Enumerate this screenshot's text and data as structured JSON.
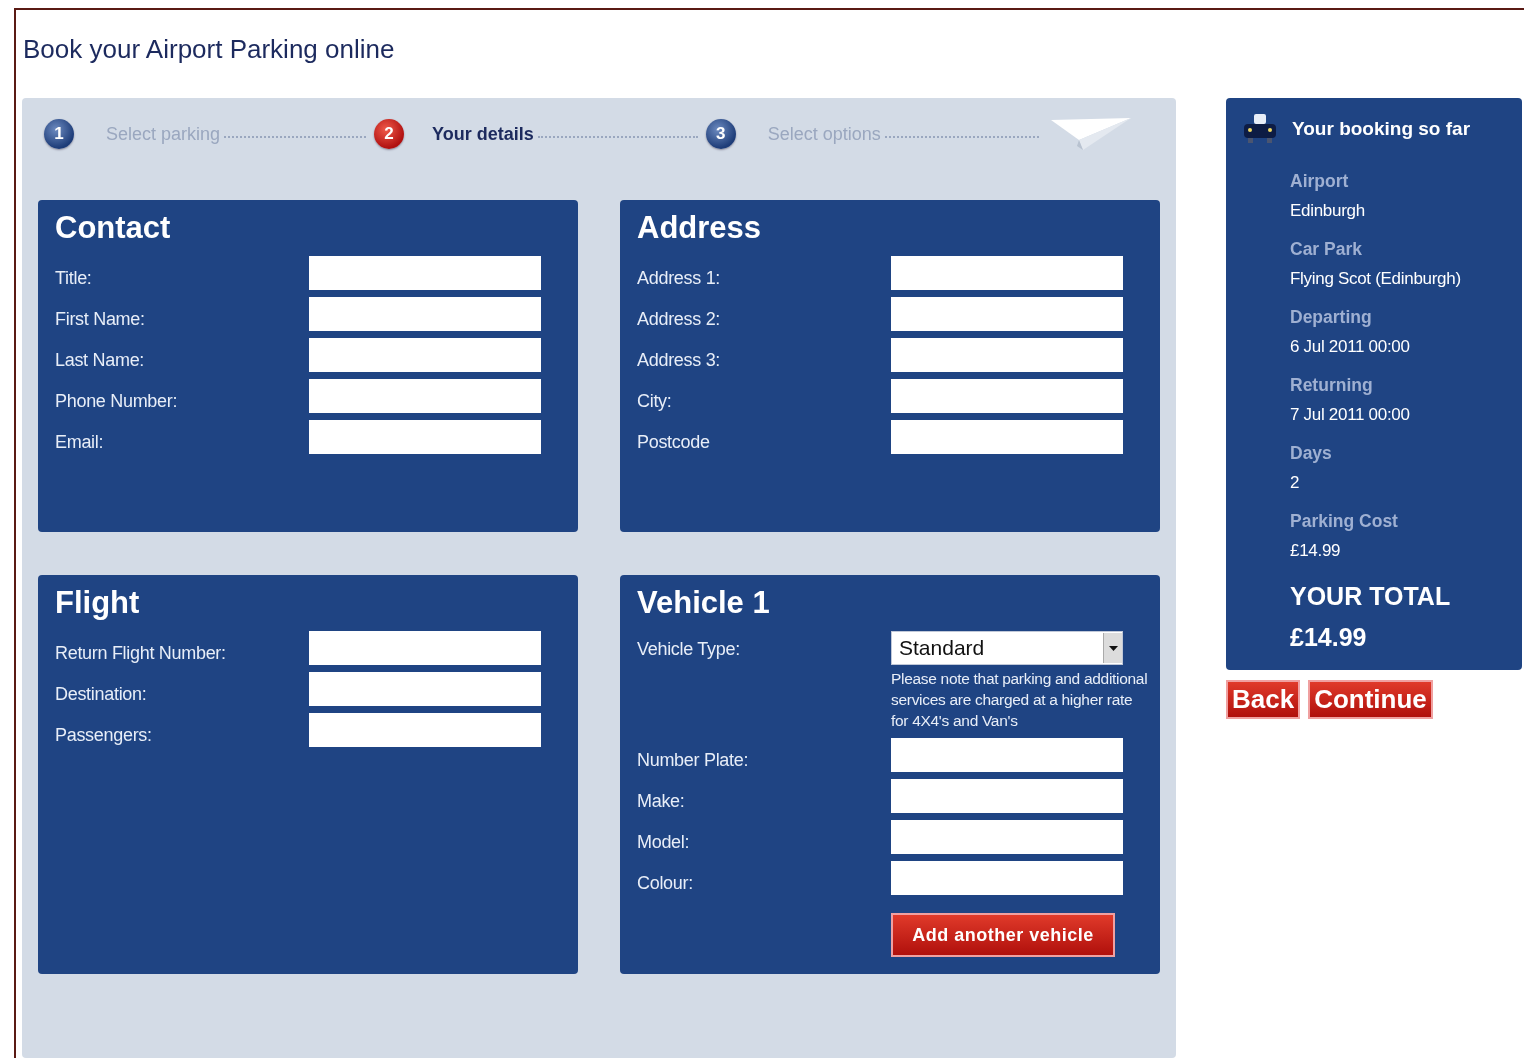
{
  "page_title": "Book your Airport Parking online",
  "steps": [
    {
      "number": "1",
      "label": "Select parking",
      "selected": false
    },
    {
      "number": "2",
      "label": "Your details",
      "selected": true
    },
    {
      "number": "3",
      "label": "Select options",
      "selected": false
    }
  ],
  "cards": [
    {
      "title": "Contact",
      "fields": [
        {
          "kind": "text",
          "label": "Title:"
        },
        {
          "kind": "text",
          "label": "First Name:"
        },
        {
          "kind": "text",
          "label": "Last Name:"
        },
        {
          "kind": "text",
          "label": "Phone Number:"
        },
        {
          "kind": "text",
          "label": "Email:"
        }
      ]
    },
    {
      "title": "Address",
      "fields": [
        {
          "kind": "text",
          "label": "Address 1:"
        },
        {
          "kind": "text",
          "label": "Address 2:"
        },
        {
          "kind": "text",
          "label": "Address 3:"
        },
        {
          "kind": "text",
          "label": "City:"
        },
        {
          "kind": "text",
          "label": "Postcode"
        }
      ]
    },
    {
      "title": "Flight",
      "fields": [
        {
          "kind": "text",
          "label": "Return Flight Number:"
        },
        {
          "kind": "text",
          "label": "Destination:"
        },
        {
          "kind": "text",
          "label": "Passengers:"
        }
      ]
    },
    {
      "title": "Vehicle 1",
      "fields": [
        {
          "kind": "select",
          "label": "Vehicle Type:",
          "value": "Standard",
          "note": "Please note that parking and additional services are charged at a higher rate for 4X4's and Van's"
        },
        {
          "kind": "text",
          "label": "Number Plate:"
        },
        {
          "kind": "text",
          "label": "Make:"
        },
        {
          "kind": "text",
          "label": "Model:"
        },
        {
          "kind": "text",
          "label": "Colour:"
        }
      ],
      "button": "Add another vehicle"
    }
  ],
  "booking": {
    "title": "Your booking so far",
    "items": [
      {
        "label": "Airport",
        "value": "Edinburgh"
      },
      {
        "label": "Car Park",
        "value": "Flying Scot (Edinburgh)"
      },
      {
        "label": "Departing",
        "value": "6 Jul 2011 00:00"
      },
      {
        "label": "Returning",
        "value": "7 Jul 2011 00:00"
      },
      {
        "label": "Days",
        "value": "2"
      },
      {
        "label": "Parking Cost",
        "value": "£14.99"
      }
    ],
    "total_label": "YOUR TOTAL",
    "total": "£14.99"
  },
  "buttons": [
    "Back",
    "Continue"
  ]
}
